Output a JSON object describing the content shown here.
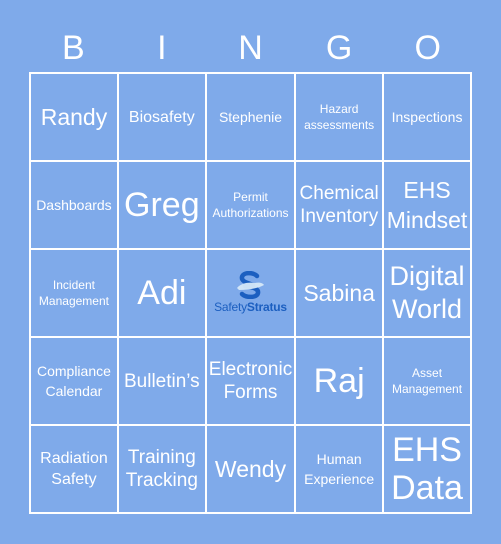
{
  "header": {
    "letters": [
      "B",
      "I",
      "N",
      "G",
      "O"
    ]
  },
  "board": {
    "rows": [
      [
        {
          "lines": [
            "Randy"
          ],
          "size": "xl"
        },
        {
          "lines": [
            "Biosafety"
          ],
          "size": "md"
        },
        {
          "lines": [
            "Stephenie"
          ],
          "size": "sm"
        },
        {
          "lines": [
            "Hazard",
            "assessments"
          ],
          "size": "xs"
        },
        {
          "lines": [
            "Inspections"
          ],
          "size": "sm"
        }
      ],
      [
        {
          "lines": [
            "Dashboards"
          ],
          "size": "sm"
        },
        {
          "lines": [
            "Greg"
          ],
          "size": "huge"
        },
        {
          "lines": [
            "Permit",
            "Authorizations"
          ],
          "size": "xs"
        },
        {
          "lines": [
            "Chemical",
            "Inventory"
          ],
          "size": "lg"
        },
        {
          "lines": [
            "EHS",
            "Mindset"
          ],
          "size": "xl"
        }
      ],
      [
        {
          "lines": [
            "Incident",
            "Management"
          ],
          "size": "xs"
        },
        {
          "lines": [
            "Adi"
          ],
          "size": "huge"
        },
        {
          "free": true,
          "logo": {
            "icon": "safetystratus-logo-icon",
            "brand_regular": "Safety",
            "brand_bold": "Stratus",
            "color": "#1c5fc0"
          }
        },
        {
          "lines": [
            "Sabina"
          ],
          "size": "xl"
        },
        {
          "lines": [
            "Digital",
            "World"
          ],
          "size": "xxl"
        }
      ],
      [
        {
          "lines": [
            "Compliance",
            "Calendar"
          ],
          "size": "sm"
        },
        {
          "lines": [
            "Bulletin’s"
          ],
          "size": "lg"
        },
        {
          "lines": [
            "Electronic",
            "Forms"
          ],
          "size": "lg"
        },
        {
          "lines": [
            "Raj"
          ],
          "size": "huge"
        },
        {
          "lines": [
            "Asset",
            "Management"
          ],
          "size": "xs"
        }
      ],
      [
        {
          "lines": [
            "Radiation",
            "Safety"
          ],
          "size": "md"
        },
        {
          "lines": [
            "Training",
            "Tracking"
          ],
          "size": "lg"
        },
        {
          "lines": [
            "Wendy"
          ],
          "size": "xl"
        },
        {
          "lines": [
            "Human",
            "Experience"
          ],
          "size": "sm"
        },
        {
          "lines": [
            "EHS",
            "Data"
          ],
          "size": "huge"
        }
      ]
    ]
  },
  "colors": {
    "background": "#7faaea",
    "grid_lines": "#ffffff",
    "text": "#ffffff",
    "logo_blue": "#1c5fc0"
  }
}
